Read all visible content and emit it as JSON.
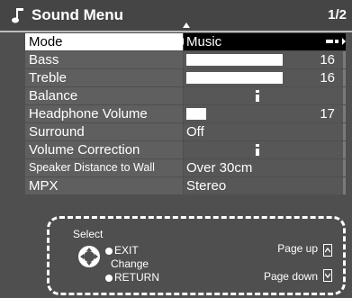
{
  "header": {
    "title": "Sound Menu",
    "page": "1/2",
    "icon": "music-note-icon"
  },
  "menu": {
    "items": [
      {
        "label": "Mode",
        "value": "Music",
        "type": "select",
        "selected": true
      },
      {
        "label": "Bass",
        "value": "16",
        "type": "bar",
        "level": 0.82
      },
      {
        "label": "Treble",
        "value": "16",
        "type": "bar",
        "level": 0.82
      },
      {
        "label": "Balance",
        "type": "balance",
        "level": 0.5
      },
      {
        "label": "Headphone Volume",
        "value": "17",
        "type": "bar",
        "level": 0.17
      },
      {
        "label": "Surround",
        "value": "Off",
        "type": "text"
      },
      {
        "label": "Volume Correction",
        "type": "balance",
        "level": 0.5
      },
      {
        "label": "Speaker Distance to Wall",
        "value": "Over 30cm",
        "type": "text"
      },
      {
        "label": "MPX",
        "value": "Stereo",
        "type": "text"
      }
    ]
  },
  "help": {
    "select": "Select",
    "exit": "EXIT",
    "change": "Change",
    "return": "RETURN",
    "page_up": "Page up",
    "page_down": "Page down"
  },
  "colors": {
    "background": "#4f4f4f",
    "label_bg": "#5f5f5f",
    "selected_label_bg": "#ffffff",
    "selected_value_bg": "#000000"
  }
}
